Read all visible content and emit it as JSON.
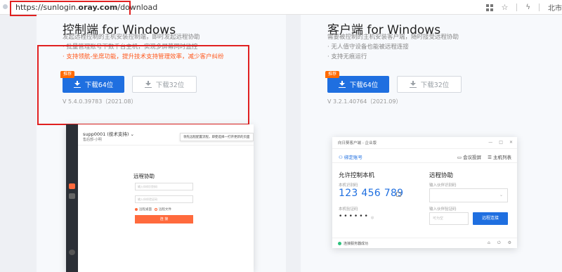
{
  "address_bar": {
    "url_prefix": "https://sunlogin.",
    "url_domain": "oray.com",
    "url_suffix": "/download",
    "right_text": "北市",
    "icons": [
      "grid-icon",
      "star-icon",
      "separator",
      "lightning-icon"
    ]
  },
  "left": {
    "title": "控制端 for Windows",
    "desc_1": "发起远程控制的主机安装控制端，即时发起远程协助",
    "desc_2": "· 批量管理账号下数千台主机，实现多屏幕同时监控",
    "highlight": "· 支持领航-坐席功能，提升技术支持管理效率，减少客户纠纷",
    "badge": "推荐",
    "primary_btn": "下载64位",
    "secondary_btn": "下载32位",
    "version": "V 5.4.0.39783（2021.08）",
    "mock": {
      "user": "supp0001 (技术支持) ⌄",
      "sub": "售后部-小明",
      "tip": "领先远程配置流程，即使选择一打开更新的页面",
      "section_title": "远程协助",
      "input_1": "输入伙伴识别码",
      "input_2": "输入伙伴验证码",
      "radio_1": "远程桌面",
      "radio_2": "远程文件",
      "button": "连 接"
    }
  },
  "right": {
    "title": "客户端 for Windows",
    "desc_1": "需要被控制的主机安装客户端，随时接受远程协助",
    "desc_2": "· 无人值守设备也能被远程连接",
    "desc_3": "· 支持无痕运行",
    "badge": "推荐",
    "primary_btn": "下载64位",
    "secondary_btn": "下载32位",
    "version": "V 3.2.1.40764（2021.09）",
    "mock": {
      "window_title": "向日葵客户端 - 企业版",
      "win_btns": [
        "—",
        "□",
        "✕"
      ],
      "bind": "绑定账号",
      "tool_1": "会议投屏",
      "tool_2": "主机列表",
      "allow_title": "允许控制本机",
      "id_label": "本机识别码",
      "id_value": "123 456 789",
      "pw_label": "本机验证码",
      "pw_value": "••••••",
      "pw_eye": "◎",
      "assist_title": "远程协助",
      "partner_id_label": "输入伙伴识别码",
      "partner_pw_label": "输入伙伴验证码",
      "partner_pw_placeholder": "可为空",
      "connect": "远程连接",
      "status": "连接服务器成功",
      "footer_icons": [
        "⌂",
        "⏻",
        "⚙"
      ]
    }
  },
  "colors": {
    "primary": "#1f6fe0",
    "accent_orange": "#ff6a00",
    "annotation_red": "#e02020"
  }
}
